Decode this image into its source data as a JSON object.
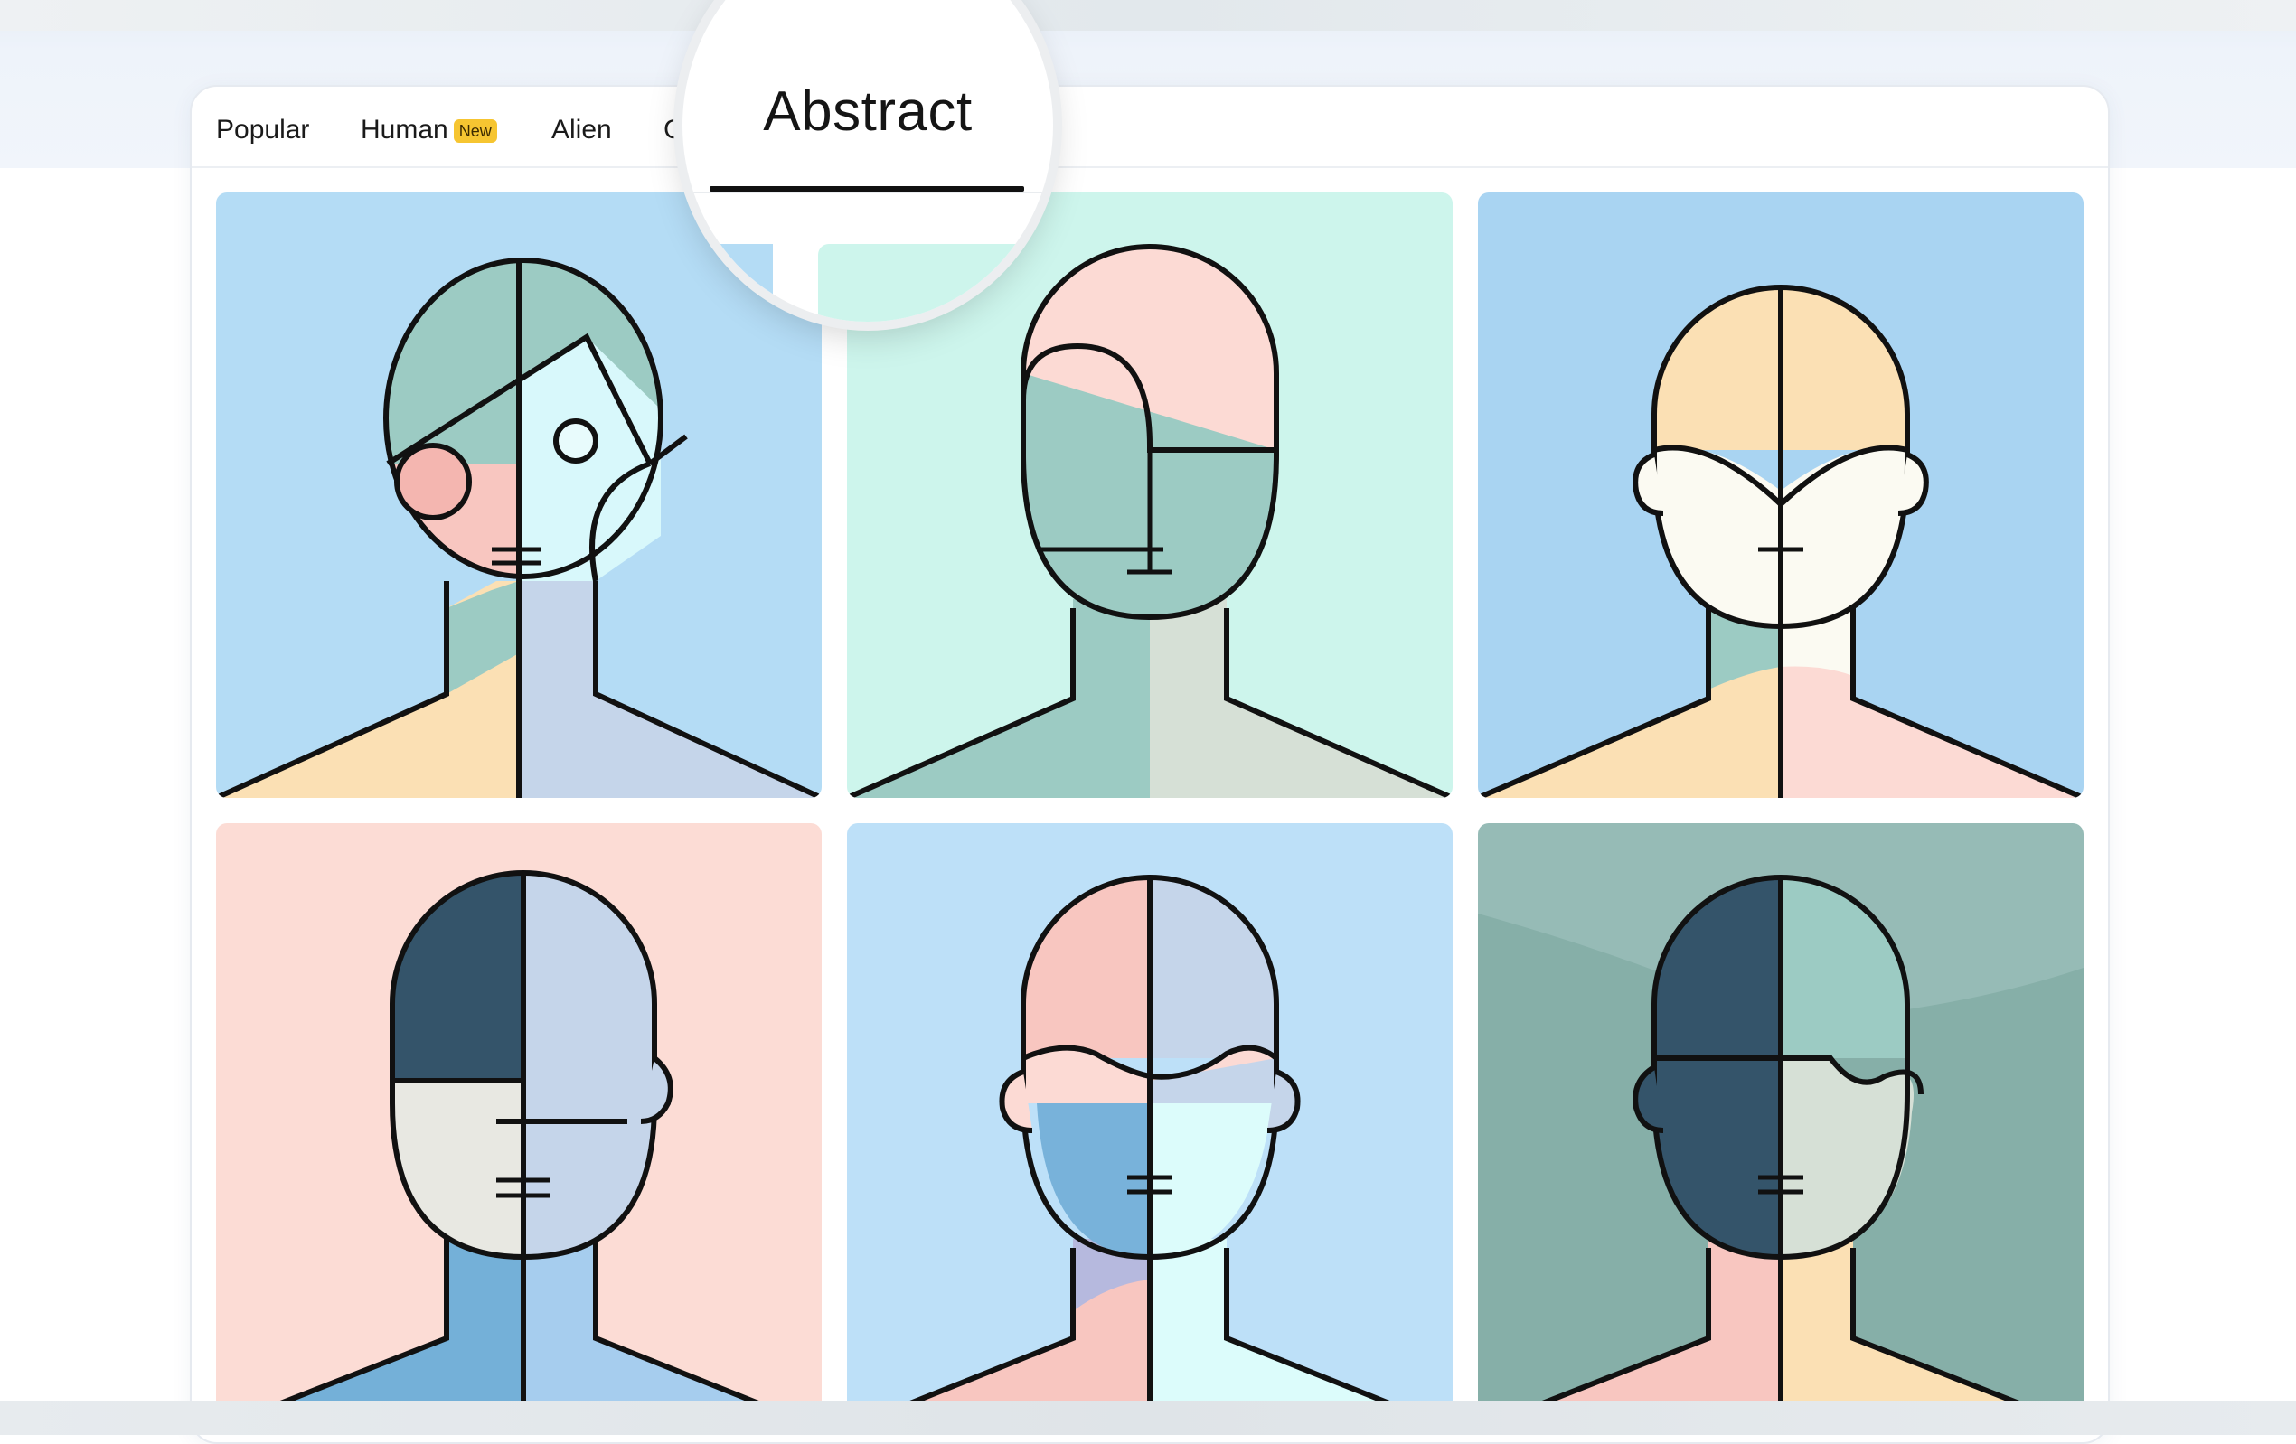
{
  "tabs": [
    {
      "label": "Popular"
    },
    {
      "label": "Human",
      "badge": "New"
    },
    {
      "label": "Alien"
    },
    {
      "label": "C"
    },
    {
      "label": "Abstract",
      "active": true
    }
  ],
  "colors": {
    "badge": "#f6c531",
    "tile_backgrounds": [
      "#b4dcf5",
      "#cdf5ec",
      "#a9d4f2",
      "#fcdcd5",
      "#bde0f8",
      "#96bbb6"
    ]
  },
  "gallery": {
    "tiles": [
      {
        "name": "abstract-avatar-1"
      },
      {
        "name": "abstract-avatar-2"
      },
      {
        "name": "abstract-avatar-3"
      },
      {
        "name": "abstract-avatar-4"
      },
      {
        "name": "abstract-avatar-5"
      },
      {
        "name": "abstract-avatar-6"
      }
    ]
  }
}
